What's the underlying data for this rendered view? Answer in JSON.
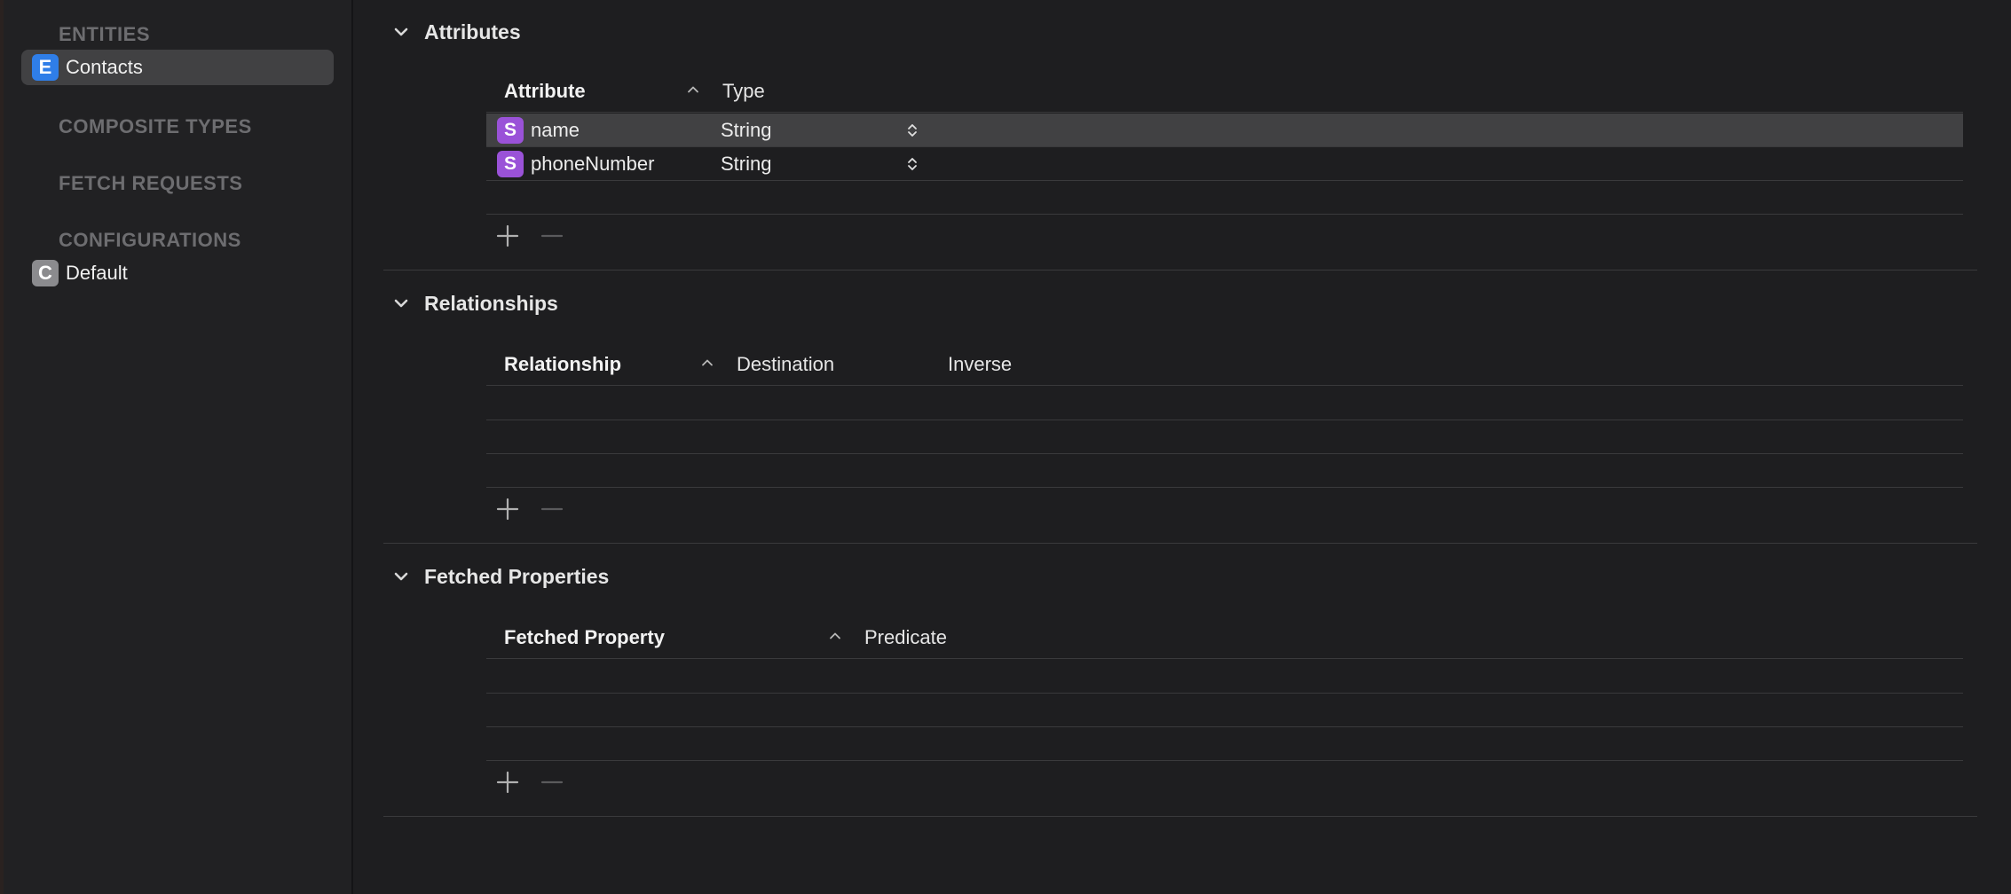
{
  "sidebar": {
    "entities_heading": "ENTITIES",
    "entities": [
      {
        "badge": "E",
        "label": "Contacts",
        "selected": true
      }
    ],
    "composite_heading": "COMPOSITE TYPES",
    "fetch_heading": "FETCH REQUESTS",
    "configurations_heading": "CONFIGURATIONS",
    "configurations": [
      {
        "badge": "C",
        "label": "Default"
      }
    ]
  },
  "attributes": {
    "title": "Attributes",
    "columns": {
      "attribute": "Attribute",
      "type": "Type"
    },
    "rows": [
      {
        "badge": "S",
        "name": "name",
        "type": "String",
        "selected": true
      },
      {
        "badge": "S",
        "name": "phoneNumber",
        "type": "String",
        "selected": false
      }
    ]
  },
  "relationships": {
    "title": "Relationships",
    "columns": {
      "relationship": "Relationship",
      "destination": "Destination",
      "inverse": "Inverse"
    }
  },
  "fetched_properties": {
    "title": "Fetched Properties",
    "columns": {
      "fetched_property": "Fetched Property",
      "predicate": "Predicate"
    }
  },
  "colors": {
    "background": "#1e1e20",
    "sidebar": "#212123",
    "selection": "#414143",
    "entity_badge": "#2f7ee8",
    "attribute_badge": "#9a52d8",
    "config_badge": "#8b8b8e"
  },
  "icons": {
    "section_toggle": "chevron-down-icon",
    "sort": "chevron-up-icon",
    "type_popup": "up-down-stepper-icon",
    "add": "plus-icon",
    "remove": "minus-icon"
  }
}
